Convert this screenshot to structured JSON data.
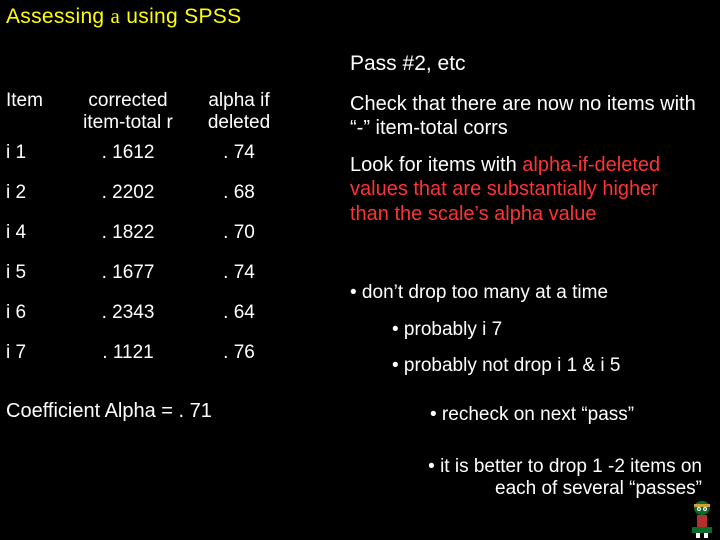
{
  "title_prefix": "Assessing ",
  "title_alpha": "a",
  "title_suffix": "  using SPSS",
  "pass_label": "Pass #2, etc",
  "table": {
    "headers": {
      "item": "Item",
      "corr_l1": "corrected",
      "corr_l2": "item-total r",
      "alpha_l1": "alpha if",
      "alpha_l2": "deleted"
    },
    "rows": [
      {
        "item": "i 1",
        "corr": ". 1612",
        "alpha": ". 74"
      },
      {
        "item": "i 2",
        "corr": ". 2202",
        "alpha": ". 68"
      },
      {
        "item": "i 4",
        "corr": ". 1822",
        "alpha": ". 70"
      },
      {
        "item": "i 5",
        "corr": ". 1677",
        "alpha": ". 74"
      },
      {
        "item": "i 6",
        "corr": ". 2343",
        "alpha": ". 64"
      },
      {
        "item": "i 7",
        "corr": ". 1121",
        "alpha": ". 76"
      }
    ]
  },
  "coefficient_line": "Coefficient Alpha =  . 71",
  "right": {
    "p1": "Check that there are now no items with  “-” item-total corrs",
    "p2_a": "Look for items with ",
    "p2_red": "alpha-if-deleted values that are substantially higher than the scale’s alpha value",
    "b1": "• don’t drop too many at a time",
    "b2": "• probably i 7",
    "b3": "• probably not drop i 1 & i 5",
    "b4": "• recheck on next “pass”",
    "b5a": "• it is better to drop 1 -2 items on",
    "b5b": "each of several “passes”"
  },
  "chart_data": {
    "type": "table",
    "title": "Coefficient Alpha = .71 (Pass #2)",
    "columns": [
      "Item",
      "corrected item-total r",
      "alpha if deleted"
    ],
    "rows": [
      [
        "i1",
        0.1612,
        0.74
      ],
      [
        "i2",
        0.2202,
        0.68
      ],
      [
        "i4",
        0.1822,
        0.7
      ],
      [
        "i5",
        0.1677,
        0.74
      ],
      [
        "i6",
        0.2343,
        0.64
      ],
      [
        "i7",
        0.1121,
        0.76
      ]
    ],
    "coefficient_alpha": 0.71
  }
}
